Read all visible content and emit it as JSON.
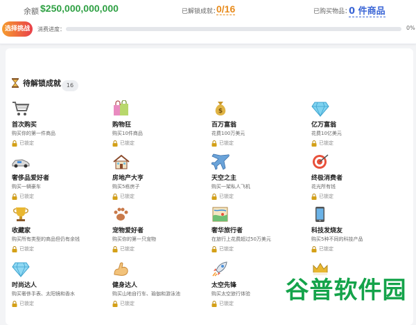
{
  "header": {
    "balance_label": "余额",
    "balance_value": "$250,000,000,000",
    "achievements_label": "已解锁成就：",
    "achievements_value": "0/16",
    "owned_label": "已购买物品：",
    "owned_value": "0 件商品",
    "challenge_button": "选择挑战",
    "progress_label": "消费进度：",
    "progress_percent": "0%",
    "progress_fraction": 0
  },
  "section": {
    "title": "待解锁成就",
    "count": "16",
    "icon": "hourglass-icon"
  },
  "achievements": [
    {
      "title": "首次购买",
      "desc": "购买你的第一件商品",
      "status": "已锁定",
      "icon": "cart-icon"
    },
    {
      "title": "购物狂",
      "desc": "购买10件商品",
      "status": "已锁定",
      "icon": "shopping-bags-icon"
    },
    {
      "title": "百万富翁",
      "desc": "花费100万美元",
      "status": "已锁定",
      "icon": "money-bag-icon"
    },
    {
      "title": "亿万富翁",
      "desc": "花费10亿美元",
      "status": "已锁定",
      "icon": "diamond-icon"
    },
    {
      "title": "奢侈品爱好者",
      "desc": "购买一辆豪车",
      "status": "已锁定",
      "icon": "race-car-icon"
    },
    {
      "title": "房地产大亨",
      "desc": "购买5栋房子",
      "status": "已锁定",
      "icon": "house-icon"
    },
    {
      "title": "天空之主",
      "desc": "购买一架私人飞机",
      "status": "已锁定",
      "icon": "airplane-icon"
    },
    {
      "title": "终极消费者",
      "desc": "花光所有钱",
      "status": "已锁定",
      "icon": "target-icon"
    },
    {
      "title": "收藏家",
      "desc": "购买所有类型的商品但仍有余钱",
      "status": "已锁定",
      "icon": "trophy-icon"
    },
    {
      "title": "宠物爱好者",
      "desc": "购买你的第一只宠物",
      "status": "已锁定",
      "icon": "paw-icon"
    },
    {
      "title": "奢华旅行者",
      "desc": "在旅行上花费超过50万美元",
      "status": "已锁定",
      "icon": "map-icon"
    },
    {
      "title": "科技发烧友",
      "desc": "购买5种不同的科技产品",
      "status": "已锁定",
      "icon": "phone-icon"
    },
    {
      "title": "时尚达人",
      "desc": "购买奢侈手表、太阳镜和香水",
      "status": "已锁定",
      "icon": "gem-icon"
    },
    {
      "title": "健身达人",
      "desc": "购买山地自行车、瑜伽和游泳池",
      "status": "已锁定",
      "icon": "flexed-arm-icon"
    },
    {
      "title": "太空先锋",
      "desc": "购买太空旅行体验",
      "status": "已锁定",
      "icon": "rocket-icon"
    },
    {
      "title": "",
      "desc": "",
      "status": "",
      "icon": "crown-icon"
    }
  ],
  "watermark": "谷普软件园",
  "colors": {
    "balance_green": "#2ea043",
    "achievement_orange": "#e88a1a",
    "owned_blue": "#3b66d6",
    "watermark_green": "#14a34a"
  }
}
